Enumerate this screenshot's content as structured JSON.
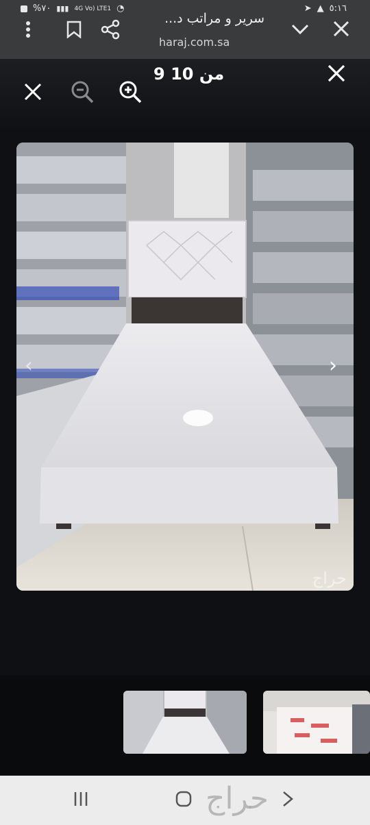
{
  "status_bar": {
    "battery": "%٧٠",
    "network": "4G Vo) LTE1",
    "time": "٥:١٦"
  },
  "browser": {
    "page_title": "سرير و مراتب د...",
    "url": "haraj.com.sa"
  },
  "viewer": {
    "counter": "9 من 10",
    "watermark": "حراج"
  },
  "navbar": {
    "watermark": "حراج"
  },
  "icons": {
    "menu": "more-vert-icon",
    "bookmark": "bookmark-icon",
    "share": "share-icon",
    "chevron": "chevron-down-icon",
    "close": "close-icon",
    "zoom_out": "zoom-out-icon",
    "zoom_in": "zoom-in-icon"
  }
}
